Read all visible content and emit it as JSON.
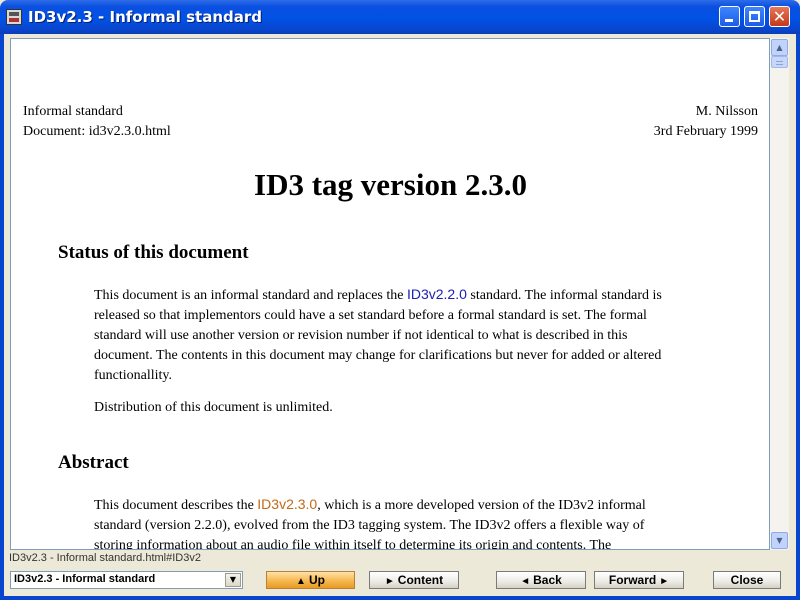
{
  "window": {
    "title": "ID3v2.3 - Informal standard"
  },
  "document": {
    "meta_left": [
      "Informal standard",
      "Document: id3v2.3.0.html"
    ],
    "meta_right": [
      "M. Nilsson",
      "3rd February 1999"
    ],
    "title": "ID3 tag version 2.3.0",
    "sections": [
      {
        "heading": "Status of this document",
        "paragraphs": [
          {
            "before": "This document is an informal standard and replaces the ",
            "link": "ID3v2.2.0",
            "after": " standard. The informal standard is released so that implementors could have a set standard before a formal standard is set. The formal standard will use another version or revision number if not identical to what is described in this document. The contents in this document may change for clarifications but never for added or altered functionallity."
          },
          {
            "text": "Distribution of this document is unlimited."
          }
        ]
      },
      {
        "heading": "Abstract",
        "paragraphs": [
          {
            "before": "This document describes the ",
            "link": "ID3v2.3.0",
            "after": ", which is a more developed version of the ID3v2 informal standard (version 2.2.0), evolved from the ID3 tagging system. The ID3v2 offers a flexible way of storing information about an audio file within itself to determine its origin and contents. The"
          }
        ]
      }
    ]
  },
  "status_text": "ID3v2.3 - Informal standard.html#ID3v2",
  "nav": {
    "select_value": "ID3v2.3 - Informal standard",
    "up_label": "Up",
    "content_label": "Content",
    "back_label": "Back",
    "forward_label": "Forward",
    "close_label": "Close"
  },
  "colors": {
    "titlebar": "#0A4FE0",
    "link_visited": "#2020b0",
    "link_active": "#c26a18",
    "up_button": "#f5b44a"
  }
}
